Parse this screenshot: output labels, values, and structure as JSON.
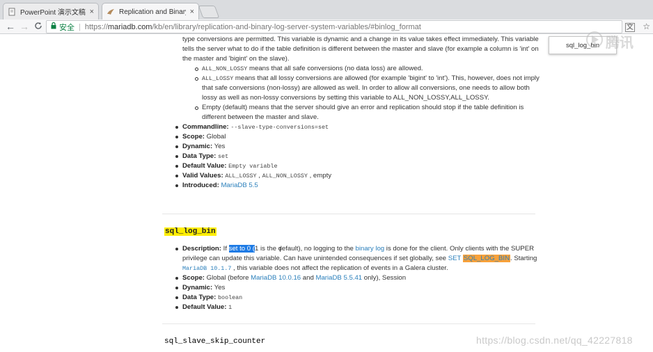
{
  "tabs": [
    {
      "label": "PowerPoint 演示文稿",
      "close": "×"
    },
    {
      "label": "Replication and Binary",
      "close": "×"
    }
  ],
  "toolbar": {
    "back": "←",
    "forward": "→",
    "reload": "C",
    "lock": "🔒",
    "secure_label": "安全",
    "separator": "|",
    "url_scheme": "https://",
    "url_host": "mariadb.com",
    "url_path": "/kb/en/library/replication-and-binary-log-server-system-variables/#binlog_format",
    "translate_icon": "文",
    "star_icon": "☆"
  },
  "find_popup": {
    "text": "sql_log_bin"
  },
  "section1": {
    "intro_fragment": "type conversions are permitted. This variable is dynamic and a change in its value takes effect immediately. This variable tells the server what to do if the table definition is different between the master and slave (for example a column is 'int' on the master and 'bigint' on the slave).",
    "options": [
      {
        "code": "ALL_NON_LOSSY",
        "text": " means that all safe conversions (no data loss) are allowed."
      },
      {
        "code": "ALL_LOSSY",
        "text": " means that all lossy conversions are allowed (for example 'bigint' to 'int'). This, however, does not imply that safe conversions (non-lossy) are allowed as well. In order to allow all conversions, one needs to allow both lossy as well as non-lossy conversions by setting this variable to ALL_NON_LOSSY,ALL_LOSSY."
      },
      {
        "code": "",
        "text": "Empty (default) means that the server should give an error and replication should stop if the table definition is different between the master and slave."
      }
    ],
    "commandline_label": "Commandline:",
    "commandline_value": "--slave-type-conversions=set",
    "scope_label": "Scope:",
    "scope_value": "Global",
    "dynamic_label": "Dynamic:",
    "dynamic_value": "Yes",
    "datatype_label": "Data Type:",
    "datatype_value": "set",
    "default_label": "Default Value:",
    "default_value": "Empty variable",
    "valid_label": "Valid Values:",
    "valid_v1": "ALL_LOSSY",
    "valid_sep": " , ",
    "valid_v2": "ALL_NON_LOSSY",
    "valid_v3": " , empty",
    "introduced_label": "Introduced:",
    "introduced_value": "MariaDB 5.5"
  },
  "section2": {
    "heading": "sql_log_bin",
    "desc_label": "Description:",
    "desc_pre": " If ",
    "desc_selected": "set to 0 (",
    "desc_mid": "1 is the default), no logging to the ",
    "desc_link1": "binary log",
    "desc_mid2": " is done for the client. Only clients with the SUPER privilege can update this variable. Can have unintended consequences if set globally, see ",
    "desc_link2": "SET",
    "desc_link3": "SQL_LOG_BIN",
    "desc_mid3": ". Starting ",
    "desc_code": "MariaDB 10.1.7",
    "desc_end": " , this variable does not affect the replication of events in a Galera cluster.",
    "scope_label": "Scope:",
    "scope_pre": "Global (before ",
    "scope_link1": "MariaDB 10.0.16",
    "scope_and": " and ",
    "scope_link2": "MariaDB 5.5.41",
    "scope_post": " only), Session",
    "dynamic_label": "Dynamic:",
    "dynamic_value": "Yes",
    "datatype_label": "Data Type:",
    "datatype_value": "boolean",
    "default_label": "Default Value:",
    "default_value": "1"
  },
  "section3": {
    "heading": "sql_slave_skip_counter"
  },
  "watermark": "https://blog.csdn.net/qq_42227818",
  "logo_text": "腾讯"
}
